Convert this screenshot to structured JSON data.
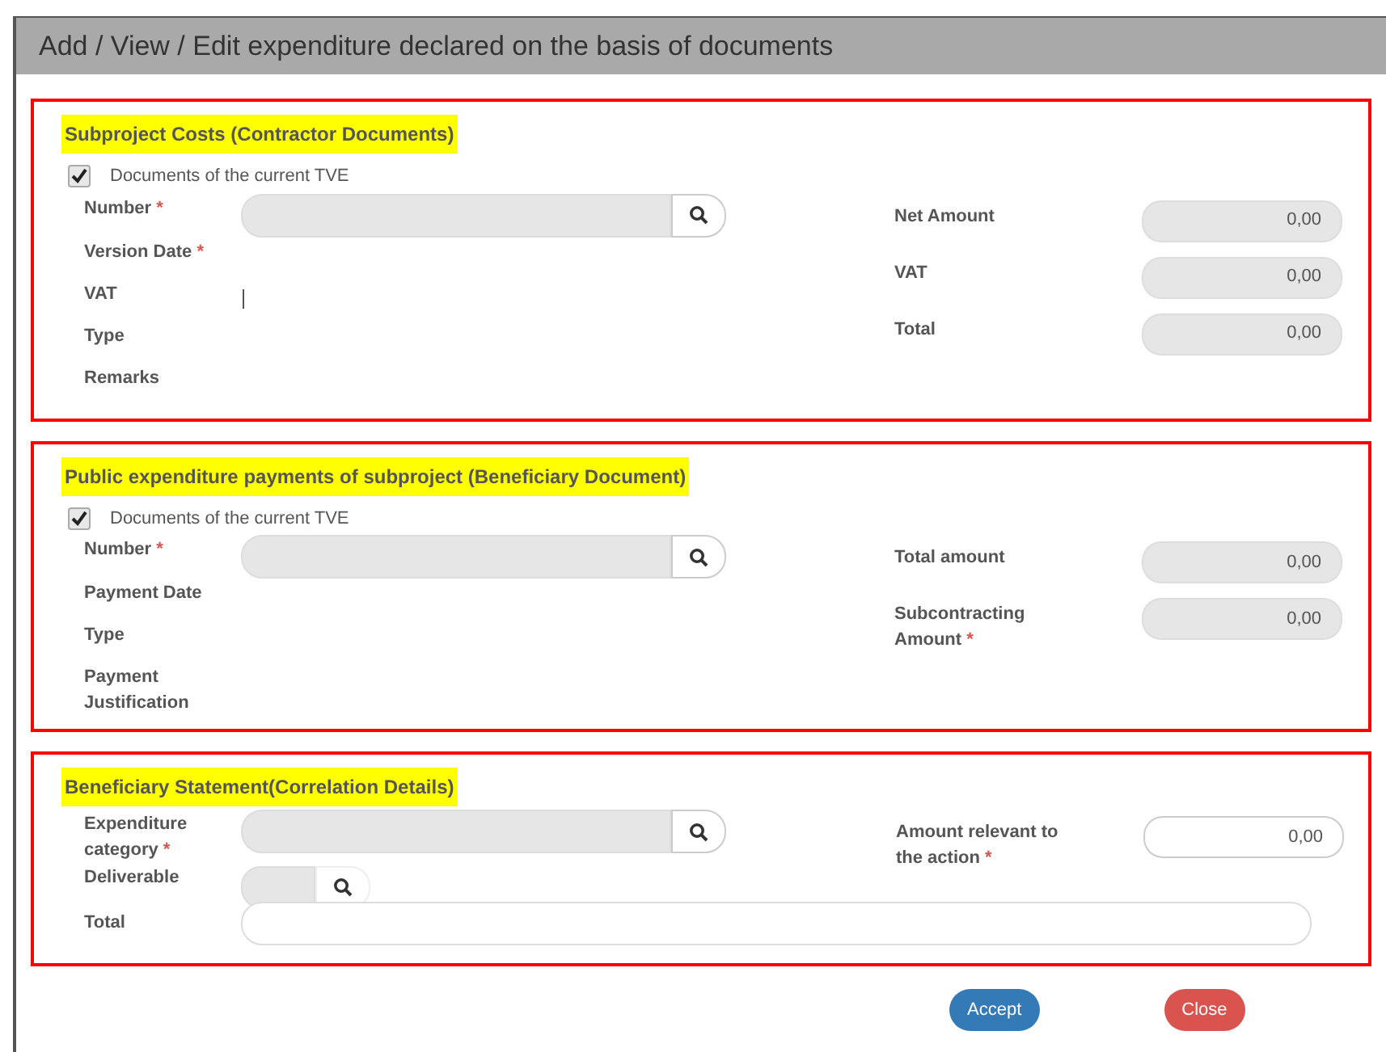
{
  "window": {
    "title": "Add / View / Edit expenditure declared on the basis of documents"
  },
  "sections": [
    {
      "title": "Subproject Costs (Contractor Documents)",
      "checkbox": {
        "label": "Documents of the current TVE",
        "checked": true
      },
      "left_fields": [
        {
          "label": "Number",
          "required_mark": "*",
          "kind": "search"
        },
        {
          "label": "Version Date",
          "required_mark": "*",
          "kind": "none"
        },
        {
          "label": "VAT",
          "kind": "caret"
        },
        {
          "label": "Type",
          "kind": "none"
        },
        {
          "label": "Remarks",
          "kind": "none"
        }
      ],
      "right_fields": [
        {
          "label": "Net Amount",
          "value": "0,00",
          "disabled": true
        },
        {
          "label": "VAT",
          "value": "0,00",
          "disabled": true
        },
        {
          "label": "Total",
          "value": "0,00",
          "disabled": true
        }
      ]
    },
    {
      "title": "Public expenditure payments of subproject (Beneficiary Document)",
      "checkbox": {
        "label": "Documents of the current TVE",
        "checked": true
      },
      "left_fields": [
        {
          "label": "Number",
          "required_mark": "*",
          "kind": "search"
        },
        {
          "label": "Payment Date",
          "kind": "none"
        },
        {
          "label": "Type",
          "kind": "none"
        },
        {
          "label": "Payment Justification",
          "kind": "none"
        }
      ],
      "right_fields": [
        {
          "label": "Total amount",
          "value": "0,00",
          "disabled": true
        },
        {
          "label": "Subcontracting Amount",
          "required_mark": "*",
          "value": "0,00",
          "disabled": true
        }
      ]
    },
    {
      "title": "Beneficiary Statement(Correlation Details)",
      "left_fields": [
        {
          "label": "Expenditure category",
          "required_mark": "*",
          "kind": "search"
        },
        {
          "label": "Deliverable",
          "kind": "small-search"
        },
        {
          "label": "Total",
          "kind": "wide-text"
        }
      ],
      "right_fields": [
        {
          "label": "Amount relevant to the action",
          "required_mark": "*",
          "value": "0,00",
          "disabled": false
        }
      ]
    }
  ],
  "buttons": [
    {
      "label": "Accept",
      "kind": "primary"
    },
    {
      "label": "Close",
      "kind": "danger"
    }
  ]
}
